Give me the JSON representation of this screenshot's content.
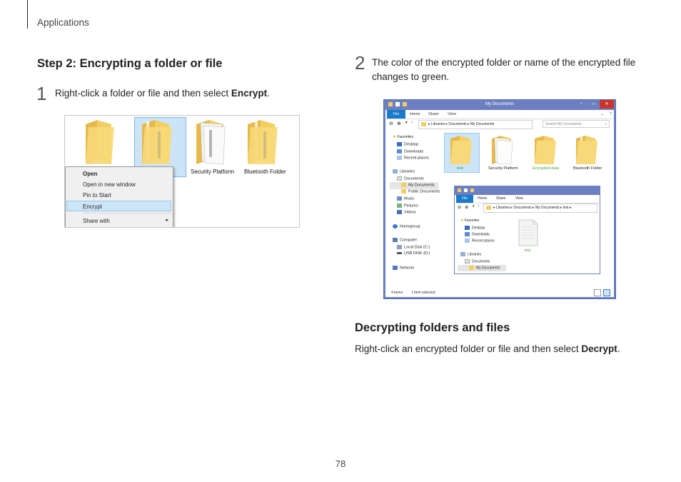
{
  "header": {
    "section": "Applications"
  },
  "page_number": "78",
  "left": {
    "heading": "Step 2: Encrypting a folder or file",
    "step_number": "1",
    "step_text_prefix": "Right-click a folder or file and then select ",
    "step_text_bold": "Encrypt",
    "step_text_suffix": ".",
    "screenshot": {
      "folders": [
        {
          "label": ""
        },
        {
          "label": ""
        },
        {
          "label": "Security Platform"
        },
        {
          "label": "Bluetooth Folder"
        }
      ],
      "context_menu": {
        "items": [
          "Open",
          "Open in new window",
          "Pin to Start",
          "Encrypt",
          "Share with"
        ],
        "submenu_arrow": "▸"
      }
    }
  },
  "right": {
    "step_number": "2",
    "step_text": "The color of the encrypted folder or name of the encrypted file changes to green.",
    "screenshot": {
      "window_title": "My Documents",
      "title_controls": [
        "–",
        "▭",
        "✕"
      ],
      "menu": {
        "file": "File",
        "home": "Home",
        "share": "Share",
        "view": "View"
      },
      "address_path": [
        "Libraries",
        "Documents",
        "My Documents"
      ],
      "search_placeholder": "Search My Documents",
      "nav": {
        "favorites": "Favorites",
        "favorites_items": [
          "Desktop",
          "Downloads",
          "Recent places"
        ],
        "libraries": "Libraries",
        "libraries_items": [
          "Documents",
          "My Documents",
          "Public Documents",
          "Music",
          "Pictures",
          "Videos"
        ],
        "homegroup": "Homegroup",
        "computer": "Computer",
        "computer_items": [
          "Local Disk (C:)",
          "USB DISK (D:)"
        ],
        "network": "Network"
      },
      "folders": [
        {
          "label": "test"
        },
        {
          "label": "Security Platform"
        },
        {
          "label": "Encrypted data"
        },
        {
          "label": "Bluetooth Folder"
        }
      ],
      "status_left": "4 items",
      "status_right": "1 item selected",
      "inner_window": {
        "menu": {
          "file": "File",
          "home": "Home",
          "share": "Share",
          "view": "View"
        },
        "address_path": [
          "Libraries",
          "Documents",
          "My Documents",
          "test"
        ],
        "nav": {
          "favorites": "Favorites",
          "favorites_items": [
            "Desktop",
            "Downloads",
            "Recent places"
          ],
          "libraries": "Libraries",
          "libraries_items": [
            "Documents",
            "My Documents"
          ]
        },
        "file_label": "test"
      }
    },
    "heading": "Decrypting folders and files",
    "text_prefix": "Right-click an encrypted folder or file and then select ",
    "text_bold": "Decrypt",
    "text_suffix": "."
  },
  "colors": {
    "encrypted_green": "#3aa635",
    "window_blue": "#6b7fc2",
    "file_tab_blue": "#1979ca",
    "folder_yellow": "#f2cf62",
    "selection_blue": "#cce4f7"
  }
}
